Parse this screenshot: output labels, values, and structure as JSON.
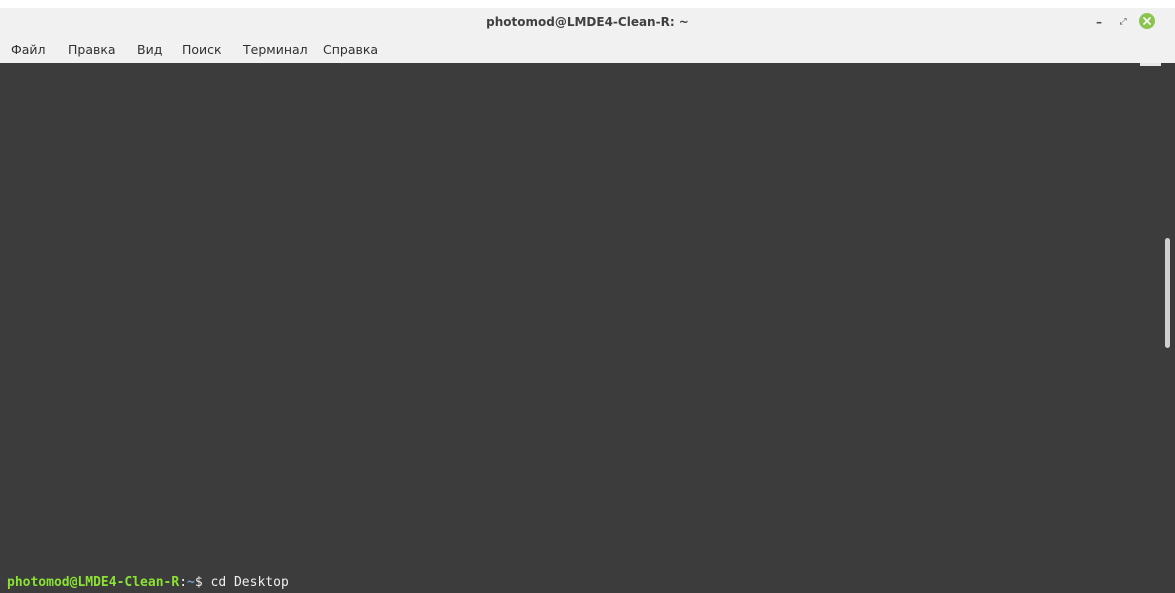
{
  "window": {
    "title": "photomod@LMDE4-Clean-R: ~",
    "controls": {
      "minimize_icon": "minimize-icon",
      "maximize_icon": "maximize-icon",
      "close_icon": "close-icon",
      "close_color": "#8cc451"
    }
  },
  "menubar": {
    "items": [
      "Файл",
      "Правка",
      "Вид",
      "Поиск",
      "Терминал",
      "Справка"
    ]
  },
  "terminal": {
    "background": "#3c3c3c",
    "prompt_user_host": "photomod@LMDE4-Clean-R",
    "prompt_sep": ":",
    "prompt_path": "~",
    "prompt_symbol": "$ ",
    "command": "cd Desktop",
    "user_color": "#8ae234",
    "path_color": "#729fcf"
  }
}
